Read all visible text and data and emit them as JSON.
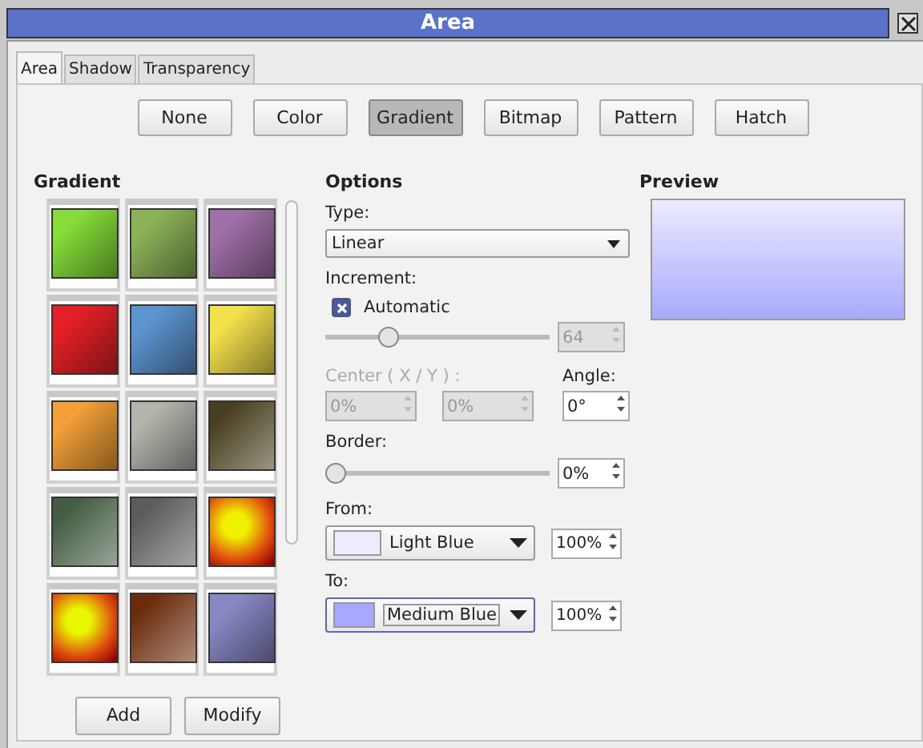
{
  "window": {
    "title": "Area"
  },
  "tabs": [
    {
      "label": "Area",
      "selected": true
    },
    {
      "label": "Shadow",
      "selected": false
    },
    {
      "label": "Transparency",
      "selected": false
    }
  ],
  "fill_types": [
    {
      "label": "None",
      "selected": false
    },
    {
      "label": "Color",
      "selected": false
    },
    {
      "label": "Gradient",
      "selected": true
    },
    {
      "label": "Bitmap",
      "selected": false
    },
    {
      "label": "Pattern",
      "selected": false
    },
    {
      "label": "Hatch",
      "selected": false
    }
  ],
  "gradient": {
    "heading": "Gradient",
    "swatches": [
      {
        "kind": "linear",
        "color": "#86dc38"
      },
      {
        "kind": "linear",
        "color": "#8cb258"
      },
      {
        "kind": "linear",
        "color": "#a070a8"
      },
      {
        "kind": "linear",
        "color": "#e42026"
      },
      {
        "kind": "linear",
        "color": "#5c94d0"
      },
      {
        "kind": "linear",
        "color": "#f4e24c"
      },
      {
        "kind": "linear",
        "color": "#f4a038"
      },
      {
        "kind": "linear",
        "color": "#b4b4ac"
      },
      {
        "kind": "linear-light",
        "color": "#484020"
      },
      {
        "kind": "linear-light",
        "color": "#445c44"
      },
      {
        "kind": "linear-light",
        "color": "#5c5c5c"
      },
      {
        "kind": "radial",
        "color": "#f0f000"
      },
      {
        "kind": "radial",
        "color": "#e8f800"
      },
      {
        "kind": "linear-light",
        "color": "#6c2c0c"
      },
      {
        "kind": "linear",
        "color": "#8888c4"
      }
    ],
    "buttons": [
      "Add",
      "Modify"
    ]
  },
  "options": {
    "heading": "Options",
    "type_label": "Type:",
    "type_value": "Linear",
    "increment_label": "Increment:",
    "automatic": {
      "label": "Automatic",
      "checked": true
    },
    "increment": {
      "level": 0.26,
      "value": "64",
      "disabled": true
    },
    "center_label": "Center ( X / Y ) :",
    "center_x": {
      "value": "0%",
      "disabled": true
    },
    "center_y": {
      "value": "0%",
      "disabled": true
    },
    "angle_label": "Angle:",
    "angle": {
      "value": "0°",
      "disabled": false
    },
    "border_label": "Border:",
    "border": {
      "level": 0,
      "value": "0%"
    },
    "from_label": "From:",
    "from": {
      "color_name": "Light Blue",
      "color": "#ececfe",
      "value": "100%"
    },
    "to_label": "To:",
    "to": {
      "color_name": "Medium Blue",
      "color": "#a8a8fe",
      "value": "100%"
    }
  },
  "preview": {
    "heading": "Preview"
  }
}
